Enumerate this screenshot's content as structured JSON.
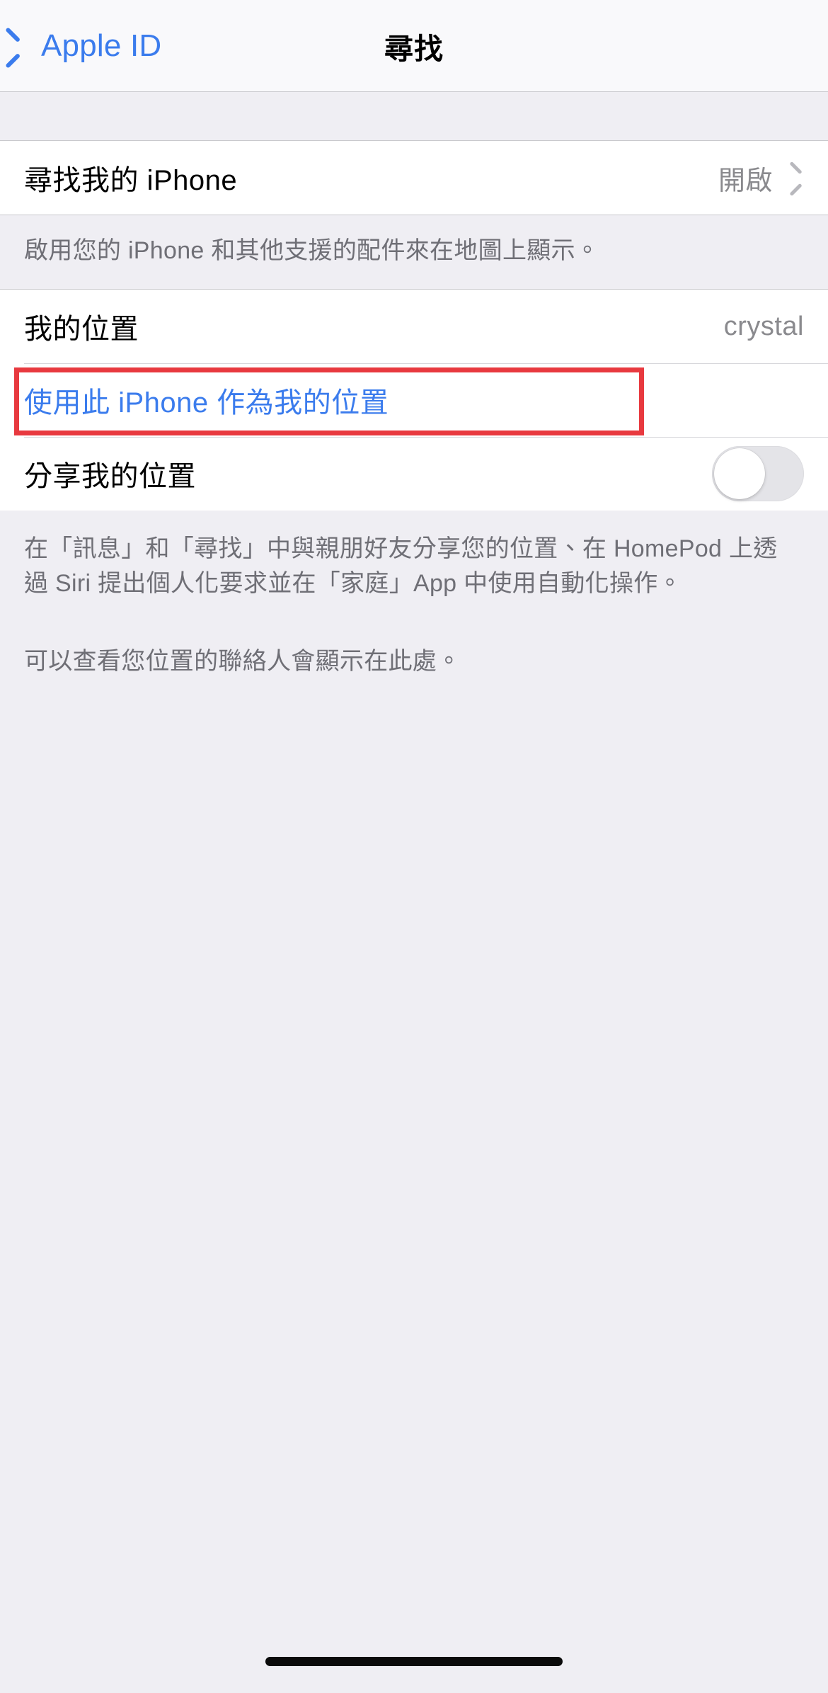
{
  "navbar": {
    "back_label": "Apple ID",
    "back_icon": "chevron-left-icon",
    "title": "尋找"
  },
  "sections": [
    {
      "id": "find-my-iphone",
      "rows": [
        {
          "label": "尋找我的 iPhone",
          "value": "開啟",
          "accessory": "chevron-right-icon"
        }
      ],
      "footer": "啟用您的 iPhone 和其他支援的配件來在地圖上顯示。"
    },
    {
      "id": "my-location",
      "rows": [
        {
          "label": "我的位置",
          "value": "crystal"
        },
        {
          "label": "使用此 iPhone 作為我的位置",
          "value": "",
          "style": "link",
          "annotated": true
        },
        {
          "label": "分享我的位置",
          "toggle": "off"
        }
      ],
      "footer_paragraphs": [
        "在「訊息」和「尋找」中與親朋好友分享您的位置、在 HomePod 上透過 Siri 提出個人化要求並在「家庭」App 中使用自動化操作。",
        "可以查看您位置的聯絡人會顯示在此處。"
      ]
    }
  ],
  "colors": {
    "accent": "#3b7ced",
    "annotation": "#e8393f",
    "background": "#efeef3",
    "row_background": "#ffffff",
    "secondary_text": "#8a8a8e"
  },
  "home_indicator": "home-indicator"
}
